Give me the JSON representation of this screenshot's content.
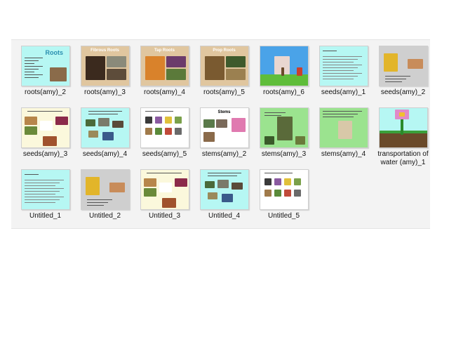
{
  "items": [
    {
      "label": "roots(amy)_2",
      "style": "roots2"
    },
    {
      "label": "roots(amy)_3",
      "style": "fibrous",
      "title": "Fibrous Roots"
    },
    {
      "label": "roots(amy)_4",
      "style": "tap",
      "title": "Tap Roots"
    },
    {
      "label": "roots(amy)_5",
      "style": "prop",
      "title": "Prop Roots"
    },
    {
      "label": "roots(amy)_6",
      "style": "scene"
    },
    {
      "label": "seeds(amy)_1",
      "style": "textcyan"
    },
    {
      "label": "seeds(amy)_2",
      "style": "seedgray"
    },
    {
      "label": "seeds(amy)_3",
      "style": "seedcream"
    },
    {
      "label": "seeds(amy)_4",
      "style": "cyancollage"
    },
    {
      "label": "seeds(amy)_5",
      "style": "whitecollage"
    },
    {
      "label": "stems(amy)_2",
      "style": "stems2",
      "title": "Stems"
    },
    {
      "label": "stems(amy)_3",
      "style": "stems3"
    },
    {
      "label": "stems(amy)_4",
      "style": "stems4"
    },
    {
      "label": "transportation of water (amy)_1",
      "style": "flower"
    },
    {
      "label": "Untitled_1",
      "style": "textcyan"
    },
    {
      "label": "Untitled_2",
      "style": "seedgray"
    },
    {
      "label": "Untitled_3",
      "style": "seedcream"
    },
    {
      "label": "Untitled_4",
      "style": "cyancollage"
    },
    {
      "label": "Untitled_5",
      "style": "whitecollage"
    }
  ],
  "colors": {
    "cyan": "#b6f7f3",
    "green": "#9be38f",
    "tan": "#e0c69f",
    "gray": "#cfcfcf",
    "cream": "#fbf8dc",
    "sky": "#4aa3e8"
  }
}
